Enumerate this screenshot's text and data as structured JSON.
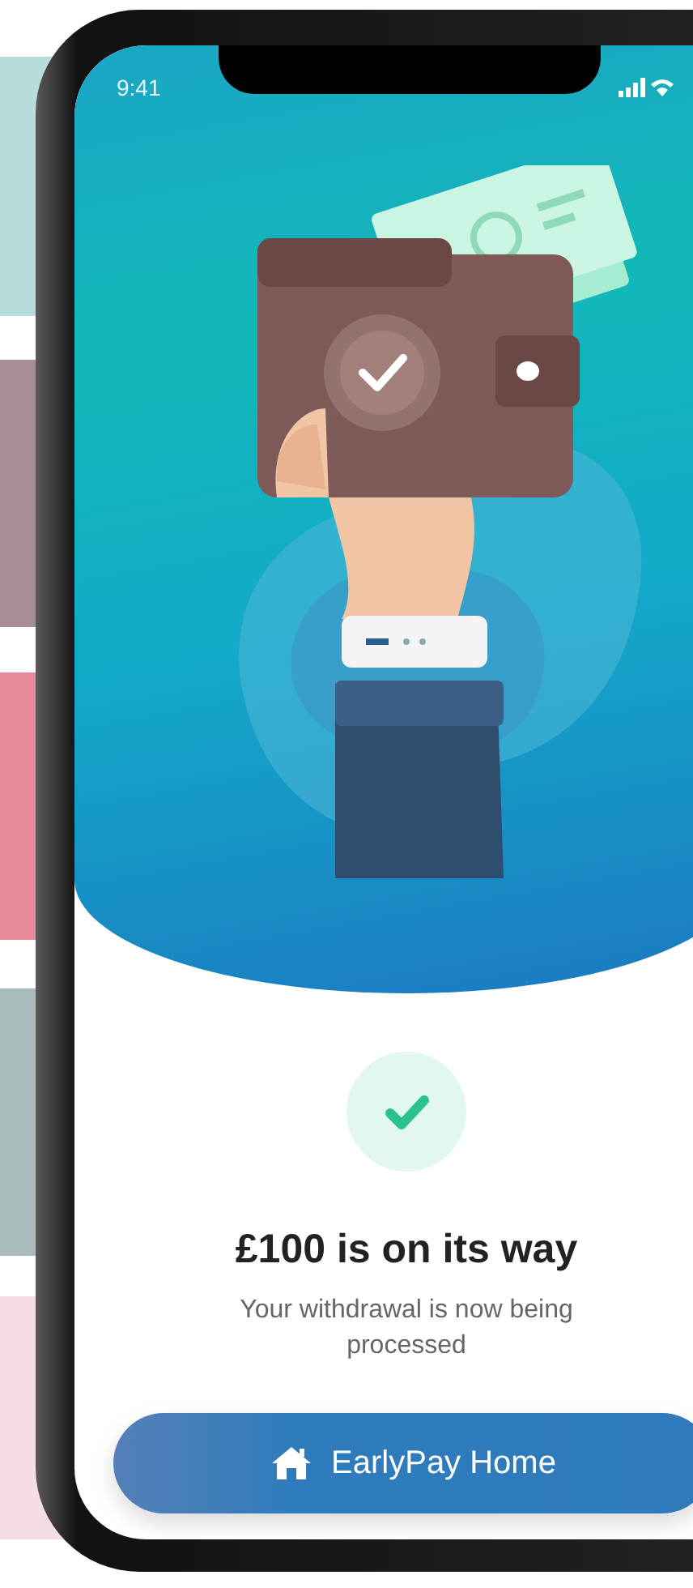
{
  "status_bar": {
    "time": "9:41"
  },
  "confirmation": {
    "title": "£100 is on its way",
    "message": "Your withdrawal is now being processed"
  },
  "button": {
    "label": "EarlyPay Home"
  }
}
